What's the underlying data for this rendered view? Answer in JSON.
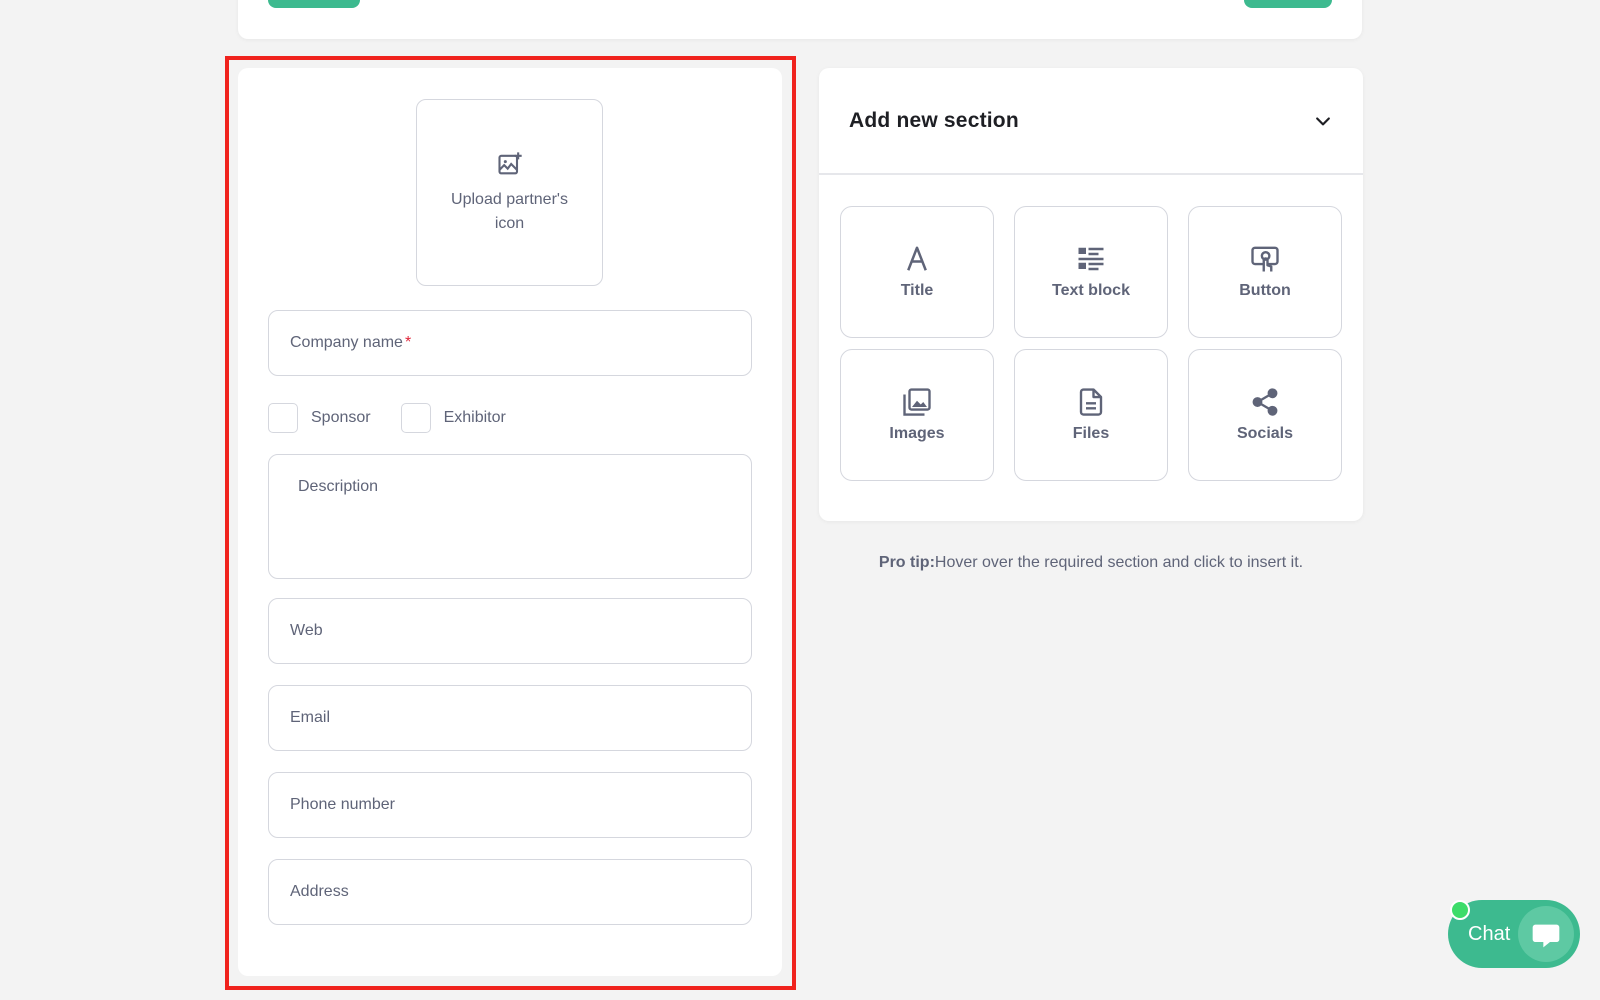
{
  "form": {
    "upload_label": "Upload partner's icon",
    "company_placeholder": "Company name",
    "required_mark": "*",
    "checkboxes": [
      {
        "label": "Sponsor"
      },
      {
        "label": "Exhibitor"
      }
    ],
    "description_placeholder": "Description",
    "web_placeholder": "Web",
    "email_placeholder": "Email",
    "phone_placeholder": "Phone number",
    "address_placeholder": "Address"
  },
  "sections": {
    "title": "Add new section",
    "tiles": [
      {
        "label": "Title",
        "icon": "title-icon"
      },
      {
        "label": "Text block",
        "icon": "text-block-icon"
      },
      {
        "label": "Button",
        "icon": "button-icon"
      },
      {
        "label": "Images",
        "icon": "images-icon"
      },
      {
        "label": "Files",
        "icon": "file-icon"
      },
      {
        "label": "Socials",
        "icon": "share-icon"
      }
    ]
  },
  "tip": {
    "prefix": "Pro tip:",
    "text": "Hover over the required section and click to insert it."
  },
  "chat": {
    "label": "Chat"
  },
  "colors": {
    "accent": "#3dba8f",
    "highlight": "#f0221d",
    "required": "#e0263a",
    "online": "#3ddc6a"
  }
}
